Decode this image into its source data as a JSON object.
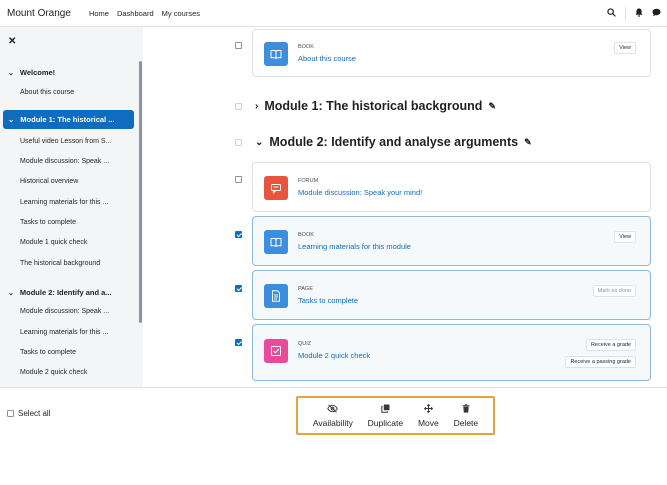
{
  "navbar": {
    "brand": "Mount Orange",
    "links": [
      "Home",
      "Dashboard",
      "My courses"
    ],
    "icons": [
      "search-icon",
      "bell-icon",
      "chat-icon"
    ]
  },
  "drawer": {
    "close_glyph": "✕",
    "sections": [
      {
        "title": "Welcome!",
        "items": [
          "About this course"
        ]
      },
      {
        "title": "Module 1: The historical ...",
        "active": true,
        "items": [
          "Useful video Lesson from S...",
          "Module discussion: Speak ...",
          "Historical overview",
          "Learning materials for this ...",
          "Tasks to complete",
          "Module 1 quick check",
          "The historical background"
        ]
      },
      {
        "title": "Module 2: Identify and a...",
        "items": [
          "Module discussion: Speak ...",
          "Learning materials for this ...",
          "Tasks to complete",
          "Module 2 quick check"
        ]
      }
    ]
  },
  "main": {
    "top_card": {
      "type": "BOOK",
      "name": "About this course",
      "badge": "View",
      "checked": false
    },
    "section1": {
      "title": "Module 1: The historical background"
    },
    "section2": {
      "title": "Module 2: Identify and analyse arguments"
    },
    "activities": [
      {
        "type": "FORUM",
        "name": "Module discussion: Speak your mind!",
        "checked": false,
        "color": "#e8553e"
      },
      {
        "type": "BOOK",
        "name": "Learning materials for this module",
        "badge": "View",
        "checked": true,
        "color": "#3e8ede"
      },
      {
        "type": "PAGE",
        "name": "Tasks to complete",
        "badge": "Mark as done",
        "checked": true,
        "color": "#3e8ede"
      },
      {
        "type": "QUIZ",
        "name": "Module 2 quick check",
        "badges": [
          "Receive a grade",
          "Receive a passing grade"
        ],
        "checked": true,
        "color": "#e74b9a"
      }
    ]
  },
  "bottombar": {
    "select_all": "Select all",
    "actions": [
      {
        "label": "Availability",
        "icon": "eye-slash-icon"
      },
      {
        "label": "Duplicate",
        "icon": "copy-icon"
      },
      {
        "label": "Move",
        "icon": "move-icon"
      },
      {
        "label": "Delete",
        "icon": "trash-icon"
      }
    ]
  },
  "colors": {
    "primary": "#0f6cbf",
    "highlight": "#e8a33a",
    "drawer_bg": "#f4f5f7"
  }
}
